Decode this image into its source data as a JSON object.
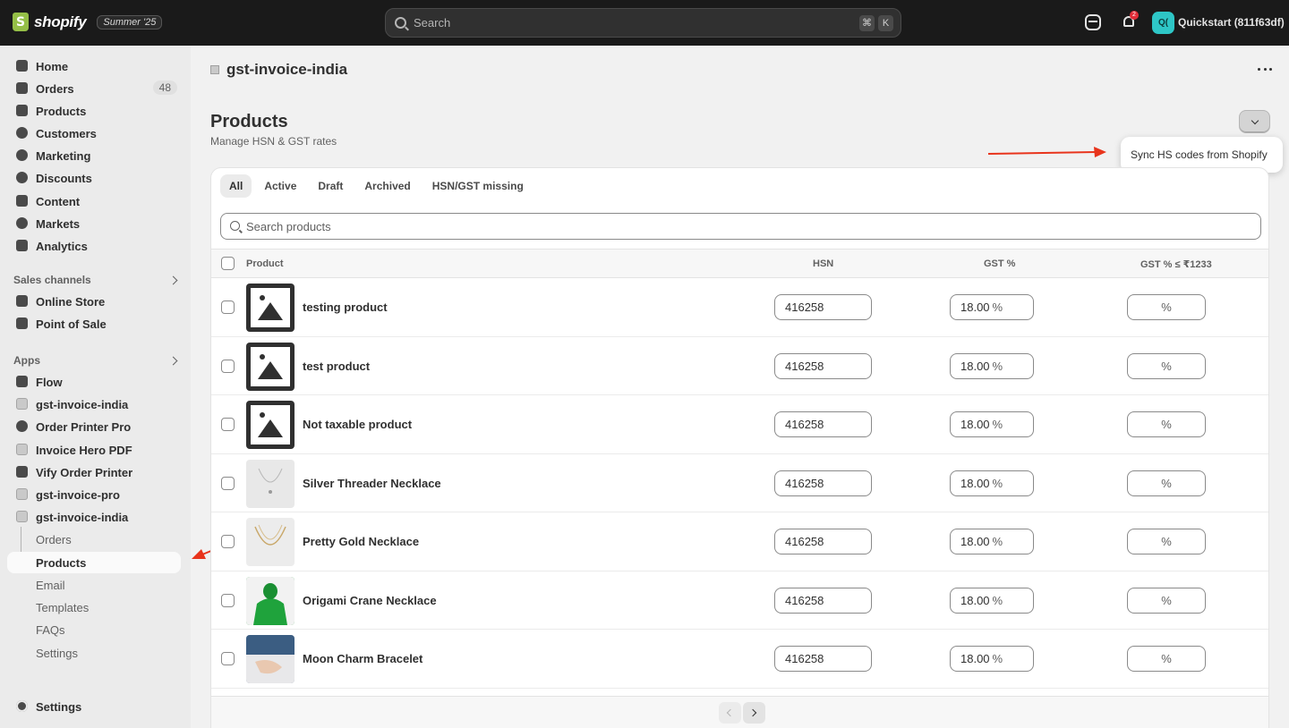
{
  "topbar": {
    "brand": "shopify",
    "edition": "Summer '25",
    "search_placeholder": "Search",
    "shortcut_keys": [
      "⌘",
      "K"
    ],
    "notifications_count": "2",
    "avatar_initials": "Q(",
    "store_name": "Quickstart (811f63df)"
  },
  "sidebar": {
    "main_items": [
      {
        "label": "Home",
        "icon": "home-icon"
      },
      {
        "label": "Orders",
        "icon": "orders-icon",
        "badge": "48"
      },
      {
        "label": "Products",
        "icon": "tag-icon"
      },
      {
        "label": "Customers",
        "icon": "person-icon"
      },
      {
        "label": "Marketing",
        "icon": "target-icon"
      },
      {
        "label": "Discounts",
        "icon": "discount-icon"
      },
      {
        "label": "Content",
        "icon": "content-icon"
      },
      {
        "label": "Markets",
        "icon": "globe-icon"
      },
      {
        "label": "Analytics",
        "icon": "bar-chart-icon"
      }
    ],
    "sales_channels_label": "Sales channels",
    "sales_channels": [
      {
        "label": "Online Store",
        "icon": "store-icon"
      },
      {
        "label": "Point of Sale",
        "icon": "pos-icon"
      }
    ],
    "apps_label": "Apps",
    "apps": [
      {
        "label": "Flow",
        "icon": "flow-icon"
      },
      {
        "label": "gst-invoice-india",
        "icon": "app-icon"
      },
      {
        "label": "Order Printer Pro",
        "icon": "printer-app-icon"
      },
      {
        "label": "Invoice Hero PDF",
        "icon": "invoice-app-icon"
      },
      {
        "label": "Vify Order Printer",
        "icon": "vify-app-icon"
      },
      {
        "label": "gst-invoice-pro",
        "icon": "app-icon"
      },
      {
        "label": "gst-invoice-india",
        "icon": "app-icon"
      }
    ],
    "app_subitems": [
      "Orders",
      "Products",
      "Email",
      "Templates",
      "FAQs",
      "Settings"
    ],
    "active_subitem": "Products",
    "settings_label": "Settings"
  },
  "app_header": {
    "title": "gst-invoice-india"
  },
  "page": {
    "title": "Products",
    "subtitle": "Manage HSN & GST rates",
    "popover_action": "Sync HS codes from Shopify"
  },
  "tabs": [
    "All",
    "Active",
    "Draft",
    "Archived",
    "HSN/GST missing"
  ],
  "active_tab": "All",
  "search": {
    "placeholder": "Search products"
  },
  "table": {
    "columns": [
      "Product",
      "HSN",
      "GST %",
      "GST % ≤ ₹1233"
    ],
    "rows": [
      {
        "name": "testing product",
        "hsn": "416258",
        "gst": "18.00",
        "gst_low": "",
        "image": "placeholder"
      },
      {
        "name": "test product",
        "hsn": "416258",
        "gst": "18.00",
        "gst_low": "",
        "image": "placeholder"
      },
      {
        "name": "Not taxable product",
        "hsn": "416258",
        "gst": "18.00",
        "gst_low": "",
        "image": "placeholder"
      },
      {
        "name": "Silver Threader Necklace",
        "hsn": "416258",
        "gst": "18.00",
        "gst_low": "",
        "image": "photo-light"
      },
      {
        "name": "Pretty Gold Necklace",
        "hsn": "416258",
        "gst": "18.00",
        "gst_low": "",
        "image": "photo-gold"
      },
      {
        "name": "Origami Crane Necklace",
        "hsn": "416258",
        "gst": "18.00",
        "gst_low": "",
        "image": "photo-green"
      },
      {
        "name": "Moon Charm Bracelet",
        "hsn": "416258",
        "gst": "18.00",
        "gst_low": "",
        "image": "photo-hand"
      }
    ],
    "percent_symbol": "%"
  },
  "colors": {
    "topbar": "#1a1a1a",
    "annotation_arrow": "#e8341c",
    "accent_green": "#95bf47"
  }
}
